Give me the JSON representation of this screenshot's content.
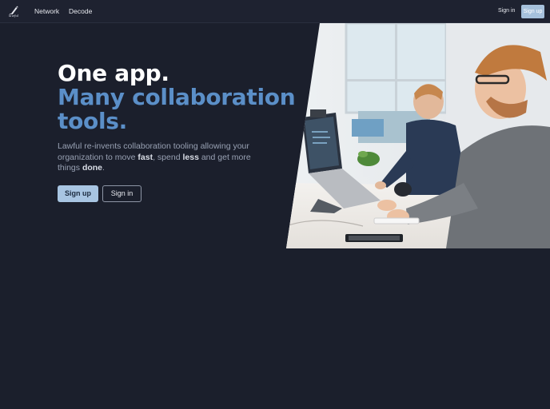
{
  "nav": {
    "logo_text": "lawful",
    "links": [
      "Network",
      "Decode"
    ],
    "signin_label": "Sign in",
    "signup_label": "Sign up"
  },
  "hero": {
    "title_line1": "One app.",
    "title_line2a": "Many collaboration",
    "title_line2b": "tools.",
    "blurb": {
      "part1": "Lawful re-invents collaboration tooling allowing your organization to move ",
      "fast": "fast",
      "part2": ", spend ",
      "less": "less",
      "part3": " and get more things ",
      "done": "done",
      "part4": "."
    },
    "primary_cta": "Sign up",
    "secondary_cta": "Sign in"
  },
  "colors": {
    "background": "#1b1f2c",
    "accent": "#5b8fc8",
    "button_primary": "#a8c5e2"
  },
  "icons": {
    "logo": "quill-logo-icon"
  }
}
